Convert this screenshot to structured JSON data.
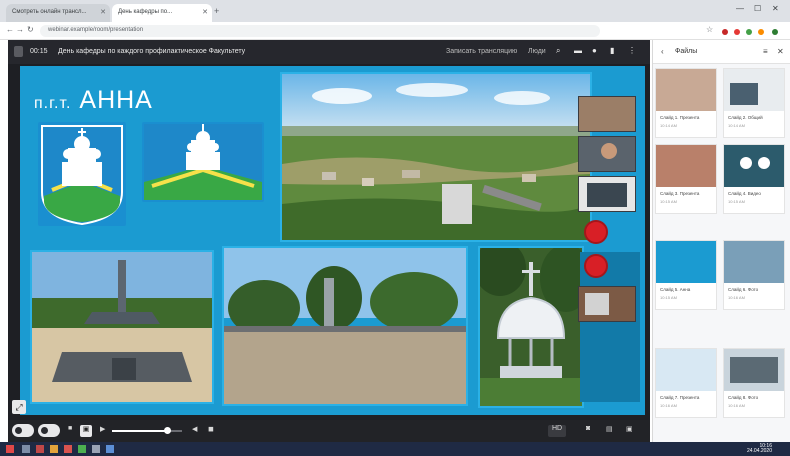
{
  "browser": {
    "tabs": [
      {
        "label": "Смотреть онлайн трансл..."
      },
      {
        "label": "День кафедры по..."
      }
    ],
    "new_tab_symbol": "+",
    "url": "webinar.example/room/presentation"
  },
  "meeting": {
    "timer": "00:15",
    "title": "День кафедры по каждого профилактическое Факультету",
    "header_right_label": "Записать трансляцию",
    "header_users": "Люди"
  },
  "slide": {
    "title_prefix": "п.г.т.",
    "title_name": "АННА"
  },
  "controls": {
    "quality_label": "HD"
  },
  "panel": {
    "title": "Файлы",
    "cards": [
      {
        "caption": "Слайд 1. Презента",
        "sub": "10:14 AM"
      },
      {
        "caption": "Слайд 2. Общий",
        "sub": "10:14 AM"
      },
      {
        "caption": "Слайд 3. Презента",
        "sub": "10:15 AM"
      },
      {
        "caption": "Слайд 4. Видео",
        "sub": "10:15 AM"
      },
      {
        "caption": "Слайд 5. Анна",
        "sub": "10:15 AM"
      },
      {
        "caption": "Слайд 6. Фото",
        "sub": "10:16 AM"
      },
      {
        "caption": "Слайд 7. Презента",
        "sub": "10:16 AM"
      },
      {
        "caption": "Слайд 8. Фото",
        "sub": "10:16 AM"
      }
    ]
  },
  "taskbar": {
    "time": "10:16",
    "date": "24.04.2020"
  },
  "colors": {
    "slide_blue": "#1b9bd1",
    "coat_green": "#39a845",
    "record_red": "#d81f26"
  }
}
